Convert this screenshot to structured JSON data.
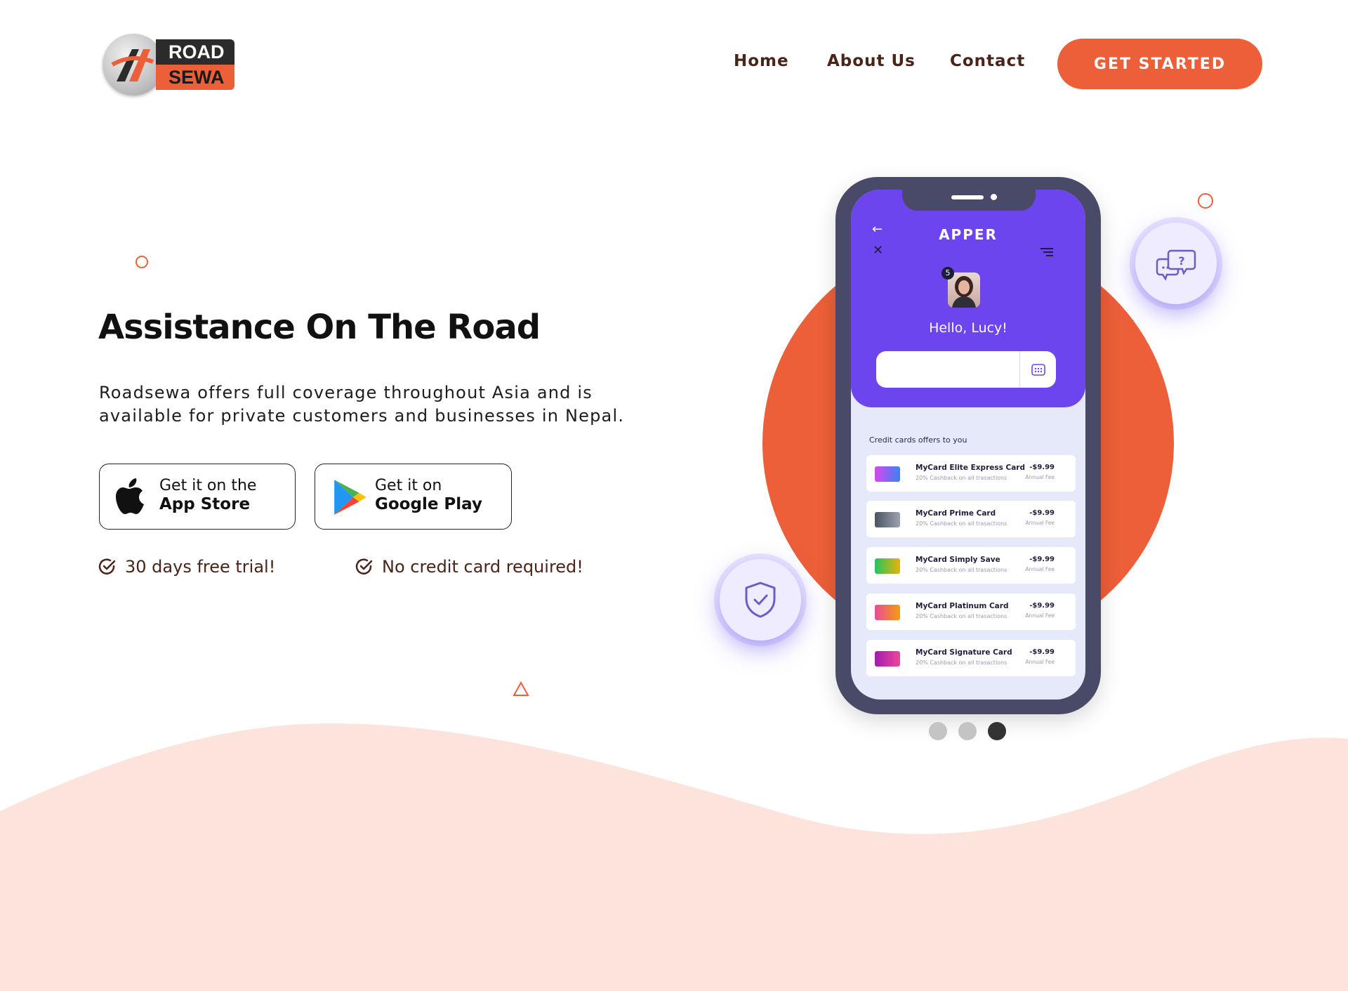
{
  "logo": {
    "line1": "ROAD",
    "line2": "SEWA"
  },
  "nav": {
    "home": "Home",
    "about": "About Us",
    "contact": "Contact",
    "cta": "GET STARTED"
  },
  "hero": {
    "title": "Assistance On The Road",
    "description": "Roadsewa offers full coverage throughout Asia and is available for private customers and businesses in Nepal."
  },
  "store": {
    "apple": {
      "line1": "Get it on the",
      "line2": "App Store",
      "icon": "apple-icon"
    },
    "google": {
      "line1": "Get it on",
      "line2": "Google Play",
      "icon": "google-play-icon"
    }
  },
  "features": [
    {
      "text": "30 days free trial!",
      "icon": "check-circle-icon"
    },
    {
      "text": "No credit card required!",
      "icon": "check-circle-icon"
    }
  ],
  "phone": {
    "app_title": "APPER",
    "badge_count": "5",
    "greeting": "Hello, Lucy!",
    "offers_title": "Credit cards offers to you",
    "offers": [
      {
        "name": "MyCard Elite Express Card",
        "sub": "20% Cashback on all trasactions",
        "price": "-$9.99",
        "fee": "Annual Fee"
      },
      {
        "name": "MyCard Prime Card",
        "sub": "20% Cashback on all trasactions",
        "price": "-$9.99",
        "fee": "Annual Fee"
      },
      {
        "name": "MyCard Simply Save",
        "sub": "20% Cashback on all trasactions",
        "price": "-$9.99",
        "fee": "Annual Fee"
      },
      {
        "name": "MyCard Platinum Card",
        "sub": "20% Cashback on all trasactions",
        "price": "-$9.99",
        "fee": "Annual Fee"
      },
      {
        "name": "MyCard Signature Card",
        "sub": "20% Cashback on all trasactions",
        "price": "-$9.99",
        "fee": "Annual Fee"
      }
    ]
  },
  "carousel": {
    "count": 3,
    "active": 3
  },
  "colors": {
    "accent": "#ec5f38",
    "nav_text": "#4a2418",
    "phone_primary": "#6c45ee",
    "wave": "#fce4dc"
  }
}
